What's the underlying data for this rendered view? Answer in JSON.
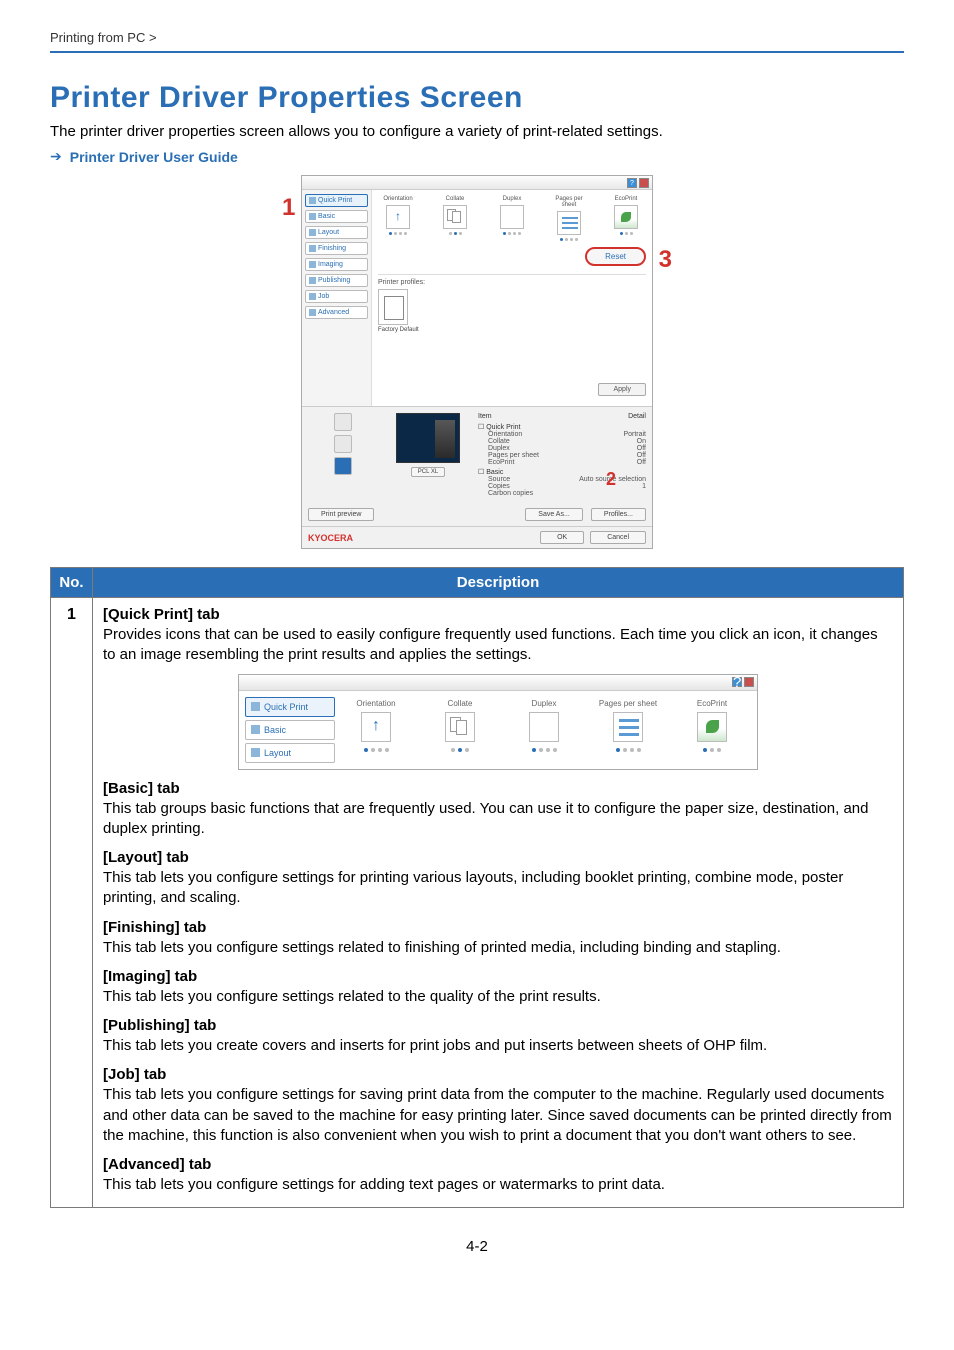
{
  "breadcrumb": "Printing from PC >",
  "heading": "Printer Driver Properties Screen",
  "intro": "The printer driver properties screen allows you to configure a variety of print-related settings.",
  "guide_link": "Printer Driver User Guide",
  "callouts": {
    "one": "1",
    "two": "2",
    "three": "3"
  },
  "dialog": {
    "tabs": {
      "quick_print": "Quick Print",
      "basic": "Basic",
      "layout": "Layout",
      "finishing": "Finishing",
      "imaging": "Imaging",
      "publishing": "Publishing",
      "job": "Job",
      "advanced": "Advanced"
    },
    "icons": {
      "orientation": "Orientation",
      "collate": "Collate",
      "duplex": "Duplex",
      "pages_per_sheet": "Pages per sheet",
      "ecoprint": "EcoPrint"
    },
    "reset": "Reset",
    "printer_profiles": "Printer profiles:",
    "factory_default": "Factory Default",
    "apply": "Apply",
    "summary": {
      "item": "Item",
      "detail": "Detail",
      "cat_quick": "Quick Print",
      "cat_basic": "Basic",
      "orientation": "Orientation",
      "orientation_v": "Portrait",
      "collate": "Collate",
      "collate_v": "On",
      "duplex": "Duplex",
      "duplex_v": "Off",
      "pps": "Pages per sheet",
      "pps_v": "Off",
      "eco": "EcoPrint",
      "eco_v": "Off",
      "source": "Source",
      "source_v": "Auto source selection",
      "copies": "Copies",
      "copies_v": "1",
      "carbon": "Carbon copies"
    },
    "pcl": "PCL XL",
    "print_preview": "Print preview",
    "save_as": "Save As...",
    "profiles_btn": "Profiles...",
    "brand": "KYOCERA",
    "ok": "OK",
    "cancel": "Cancel"
  },
  "table": {
    "head_no": "No.",
    "head_desc": "Description",
    "row1_no": "1",
    "quick_title": "[Quick Print] tab",
    "quick_p": "Provides icons that can be used to easily configure frequently used functions. Each time you click an icon, it changes to an image resembling the print results and applies the settings.",
    "basic_title": "[Basic] tab",
    "basic_p": "This tab groups basic functions that are frequently used. You can use it to configure the paper size, destination, and duplex printing.",
    "layout_title": "[Layout] tab",
    "layout_p": "This tab lets you configure settings for printing various layouts, including booklet printing, combine mode, poster printing, and scaling.",
    "finishing_title": "[Finishing] tab",
    "finishing_p": "This tab lets you configure settings related to finishing of printed media, including binding and stapling.",
    "imaging_title": "[Imaging] tab",
    "imaging_p": "This tab lets you configure settings related to the quality of the print results.",
    "publishing_title": "[Publishing] tab",
    "publishing_p": "This tab lets you create covers and inserts for print jobs and put inserts between sheets of OHP film.",
    "job_title": "[Job] tab",
    "job_p": "This tab lets you configure settings for saving print data from the computer to the machine. Regularly used documents and other data can be saved to the machine for easy printing later. Since saved documents can be printed directly from the machine, this function is also convenient when you wish to print a document that you don't want others to see.",
    "advanced_title": "[Advanced] tab",
    "advanced_p": "This tab lets you configure settings for adding text pages or watermarks to print data."
  },
  "page_num": "4-2"
}
